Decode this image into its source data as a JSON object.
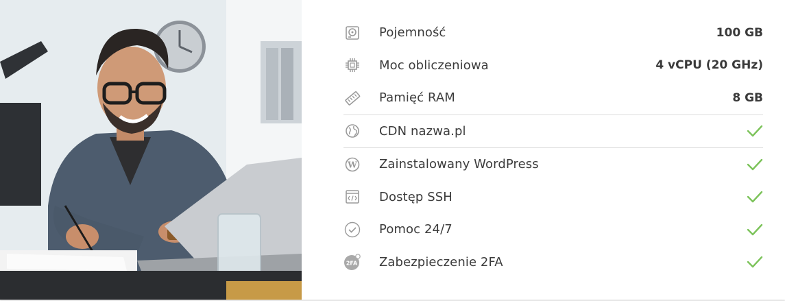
{
  "specs": [
    {
      "icon": "hdd-icon",
      "label": "Pojemność",
      "value": "100 GB"
    },
    {
      "icon": "cpu-icon",
      "label": "Moc obliczeniowa",
      "value": "4 vCPU (20 GHz)"
    },
    {
      "icon": "ram-icon",
      "label": "Pamięć RAM",
      "value": "8 GB"
    },
    {
      "icon": "globe-icon",
      "label": "CDN nazwa.pl",
      "value": "✓"
    },
    {
      "icon": "wordpress-icon",
      "label": "Zainstalowany WordPress",
      "value": "✓"
    },
    {
      "icon": "code-window-icon",
      "label": "Dostęp SSH",
      "value": "✓"
    },
    {
      "icon": "check-circle-icon",
      "label": "Pomoc 24/7",
      "value": "✓"
    },
    {
      "icon": "2fa-badge-icon",
      "label": "Zabezpieczenie 2FA",
      "value": "✓"
    }
  ],
  "colors": {
    "check": "#7cc35a",
    "icon": "#9a9a9a",
    "text": "#3c3c3c",
    "divider": "#dcdcdc"
  },
  "badge_2fa": "2FA"
}
